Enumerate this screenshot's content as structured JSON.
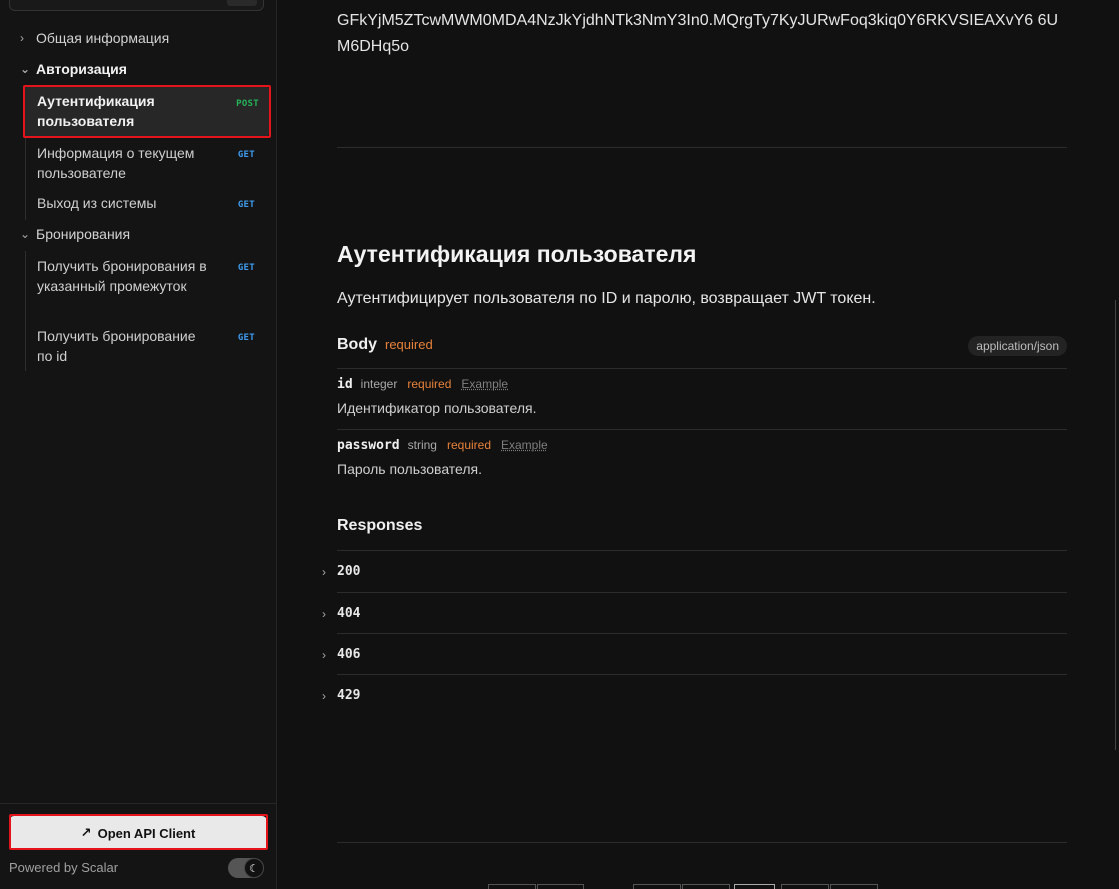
{
  "sidebar": {
    "groups": [
      {
        "label": "Общая информация",
        "chevron": "chevron-right-icon"
      },
      {
        "label": "Авторизация",
        "chevron": "chevron-down-icon"
      },
      {
        "label": "Бронирования",
        "chevron": "chevron-down-icon"
      }
    ],
    "items": [
      {
        "label": "Аутентификация пользователя",
        "method": "POST"
      },
      {
        "label": "Информация о текущем пользователе",
        "method": "GET"
      },
      {
        "label": "Выход из системы",
        "method": "GET"
      },
      {
        "label": "Получить бронирования в указанный промежуток",
        "method": "GET"
      },
      {
        "label": "Получить бронирование по id",
        "method": "GET"
      }
    ],
    "footer": {
      "open_client_label": "Open API Client",
      "open_client_icon": "arrow-up-right-icon",
      "powered_by": "Powered by Scalar",
      "theme_icon": "moon-icon"
    }
  },
  "main": {
    "token_text": "GFkYjM5ZTcwMWM0MDA4NzJkYjdhNTk3NmY3In0.MQrgTy7KyJURwFoq3kiq0Y6RKVSIEAXvY6 6UM6DHq5o",
    "section_title": "Аутентификация пользователя",
    "section_description": "Аутентифицирует пользователя по ID и паролю, возвращает JWT токен.",
    "body": {
      "title": "Body",
      "required": "required",
      "content_type": "application/json",
      "params": [
        {
          "name": "id",
          "type": "integer",
          "required": "required",
          "example": "Example",
          "description": "Идентификатор пользователя."
        },
        {
          "name": "password",
          "type": "string",
          "required": "required",
          "example": "Example",
          "description": "Пароль пользователя."
        }
      ]
    },
    "responses_title": "Responses",
    "responses": [
      "200",
      "404",
      "406",
      "429"
    ]
  },
  "colors": {
    "accent_post": "#25b45a",
    "accent_get": "#3d9cf0",
    "required": "#e8823a",
    "highlight_box": "#e5141b"
  }
}
